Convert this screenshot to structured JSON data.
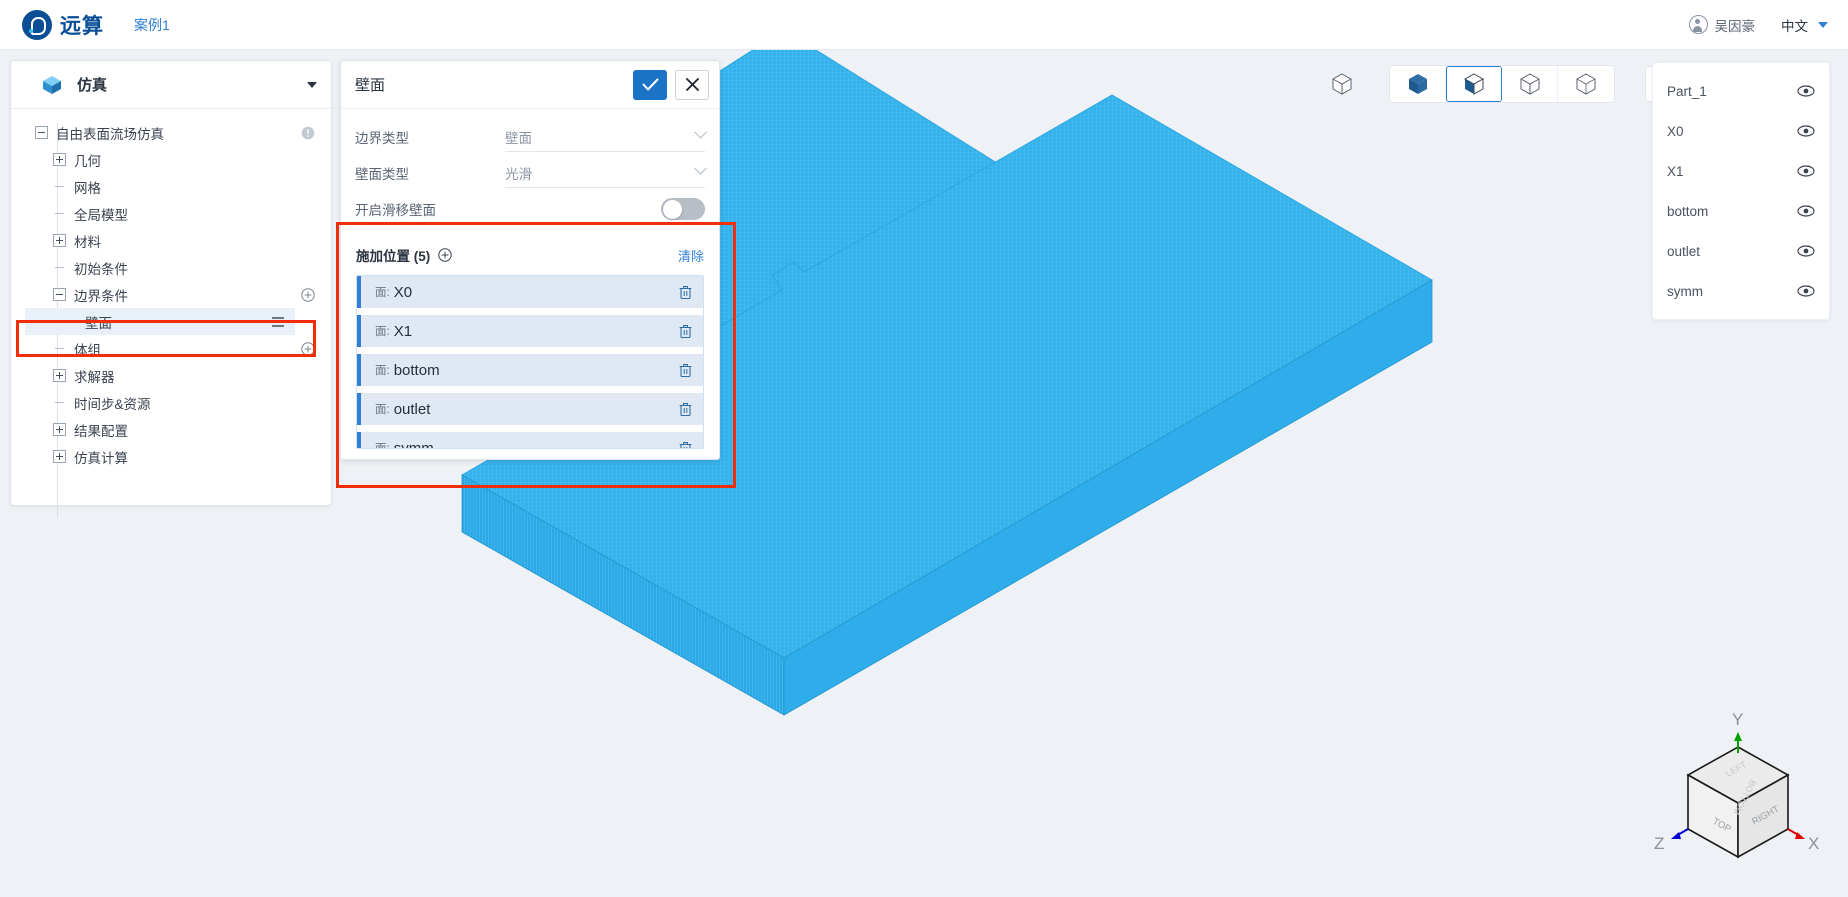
{
  "topbar": {
    "brand_name": "远算",
    "case_name": "案例1",
    "user_name": "吴因豪",
    "language": "中文"
  },
  "tree_panel": {
    "header_label": "仿真",
    "header_icon": "cube-icon",
    "items": [
      {
        "label": "自由表面流场仿真",
        "indent": 0,
        "toggle": "minus",
        "trailing": "info"
      },
      {
        "label": "几何",
        "indent": 1,
        "toggle": "plus",
        "trailing": ""
      },
      {
        "label": "网格",
        "indent": 1,
        "toggle": "leaf",
        "trailing": ""
      },
      {
        "label": "全局模型",
        "indent": 1,
        "toggle": "leaf",
        "trailing": ""
      },
      {
        "label": "材料",
        "indent": 1,
        "toggle": "plus",
        "trailing": ""
      },
      {
        "label": "初始条件",
        "indent": 1,
        "toggle": "leaf",
        "trailing": ""
      },
      {
        "label": "边界条件",
        "indent": 1,
        "toggle": "minus",
        "trailing": "add"
      },
      {
        "label": "壁面",
        "indent": 2,
        "toggle": "leaf",
        "trailing": "menu",
        "selected": true
      },
      {
        "label": "体组",
        "indent": 1,
        "toggle": "leaf",
        "trailing": "add"
      },
      {
        "label": "求解器",
        "indent": 1,
        "toggle": "plus",
        "trailing": ""
      },
      {
        "label": "时间步&资源",
        "indent": 1,
        "toggle": "leaf",
        "trailing": ""
      },
      {
        "label": "结果配置",
        "indent": 1,
        "toggle": "plus",
        "trailing": ""
      },
      {
        "label": "仿真计算",
        "indent": 1,
        "toggle": "plus",
        "trailing": ""
      }
    ]
  },
  "dialog": {
    "title": "壁面",
    "confirm_icon": "check-icon",
    "close_icon": "close-icon",
    "fields": [
      {
        "label": "边界类型",
        "value": "壁面",
        "control": "select"
      },
      {
        "label": "壁面类型",
        "value": "光滑",
        "control": "select"
      },
      {
        "label": "开启滑移壁面",
        "value": "",
        "control": "switch",
        "switch_on": false
      }
    ],
    "position_section": {
      "title": "施加位置 (5)",
      "add_icon": "plus-circle-icon",
      "clear_label": "清除",
      "items": [
        {
          "prefix": "面:",
          "name": "X0"
        },
        {
          "prefix": "面:",
          "name": "X1"
        },
        {
          "prefix": "面:",
          "name": "bottom"
        },
        {
          "prefix": "面:",
          "name": "outlet"
        },
        {
          "prefix": "面:",
          "name": "symm"
        }
      ]
    }
  },
  "viewport": {
    "toolbar": [
      {
        "name": "wireframe-cube-icon",
        "active": false,
        "style": "plain"
      },
      {
        "name": "solid-cube-icon",
        "active": false,
        "style": "group"
      },
      {
        "name": "shaded-cube-icon",
        "active": true,
        "style": "group"
      },
      {
        "name": "outline-cube-icon",
        "active": false,
        "style": "group"
      },
      {
        "name": "transparent-cube-icon",
        "active": false,
        "style": "group"
      },
      {
        "name": "reset-view-icon",
        "active": false,
        "style": "single"
      }
    ],
    "parts": [
      {
        "label": "Part_1",
        "visible": true
      },
      {
        "label": "X0",
        "visible": true
      },
      {
        "label": "X1",
        "visible": true
      },
      {
        "label": "bottom",
        "visible": true
      },
      {
        "label": "outlet",
        "visible": true
      },
      {
        "label": "symm",
        "visible": true
      }
    ],
    "axis_widget": {
      "axis_y": "Y",
      "axis_x": "X",
      "axis_z": "Z",
      "face_top": "TOP",
      "face_right": "RIGHT",
      "face_left": "LEFT",
      "face_bottom": "BOTTOM",
      "face_front": "FRONT"
    },
    "model_color": "#33b2ec"
  },
  "colors": {
    "accent": "#2f7fd6",
    "brand": "#0a4f96",
    "annotation": "#f22d0a",
    "model": "#33b2ec"
  }
}
